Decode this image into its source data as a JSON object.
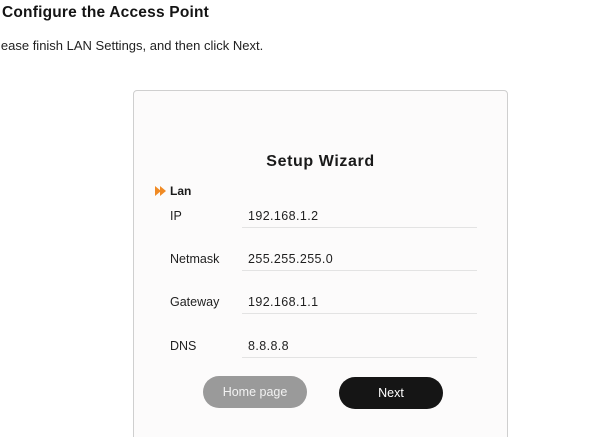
{
  "page": {
    "title": "Configure the Access Point",
    "instruction": "lease finish LAN Settings, and then click Next."
  },
  "wizard": {
    "title": "Setup Wizard",
    "section_label": "Lan",
    "section_icon": "double-arrow-right-icon",
    "accent_color": "#f08a24",
    "fields": [
      {
        "label": "IP",
        "value": "192.168.1.2"
      },
      {
        "label": "Netmask",
        "value": "255.255.255.0"
      },
      {
        "label": "Gateway",
        "value": "192.168.1.1"
      },
      {
        "label": "DNS",
        "value": "8.8.8.8"
      }
    ],
    "buttons": {
      "home_label": "Home page",
      "next_label": "Next"
    }
  }
}
